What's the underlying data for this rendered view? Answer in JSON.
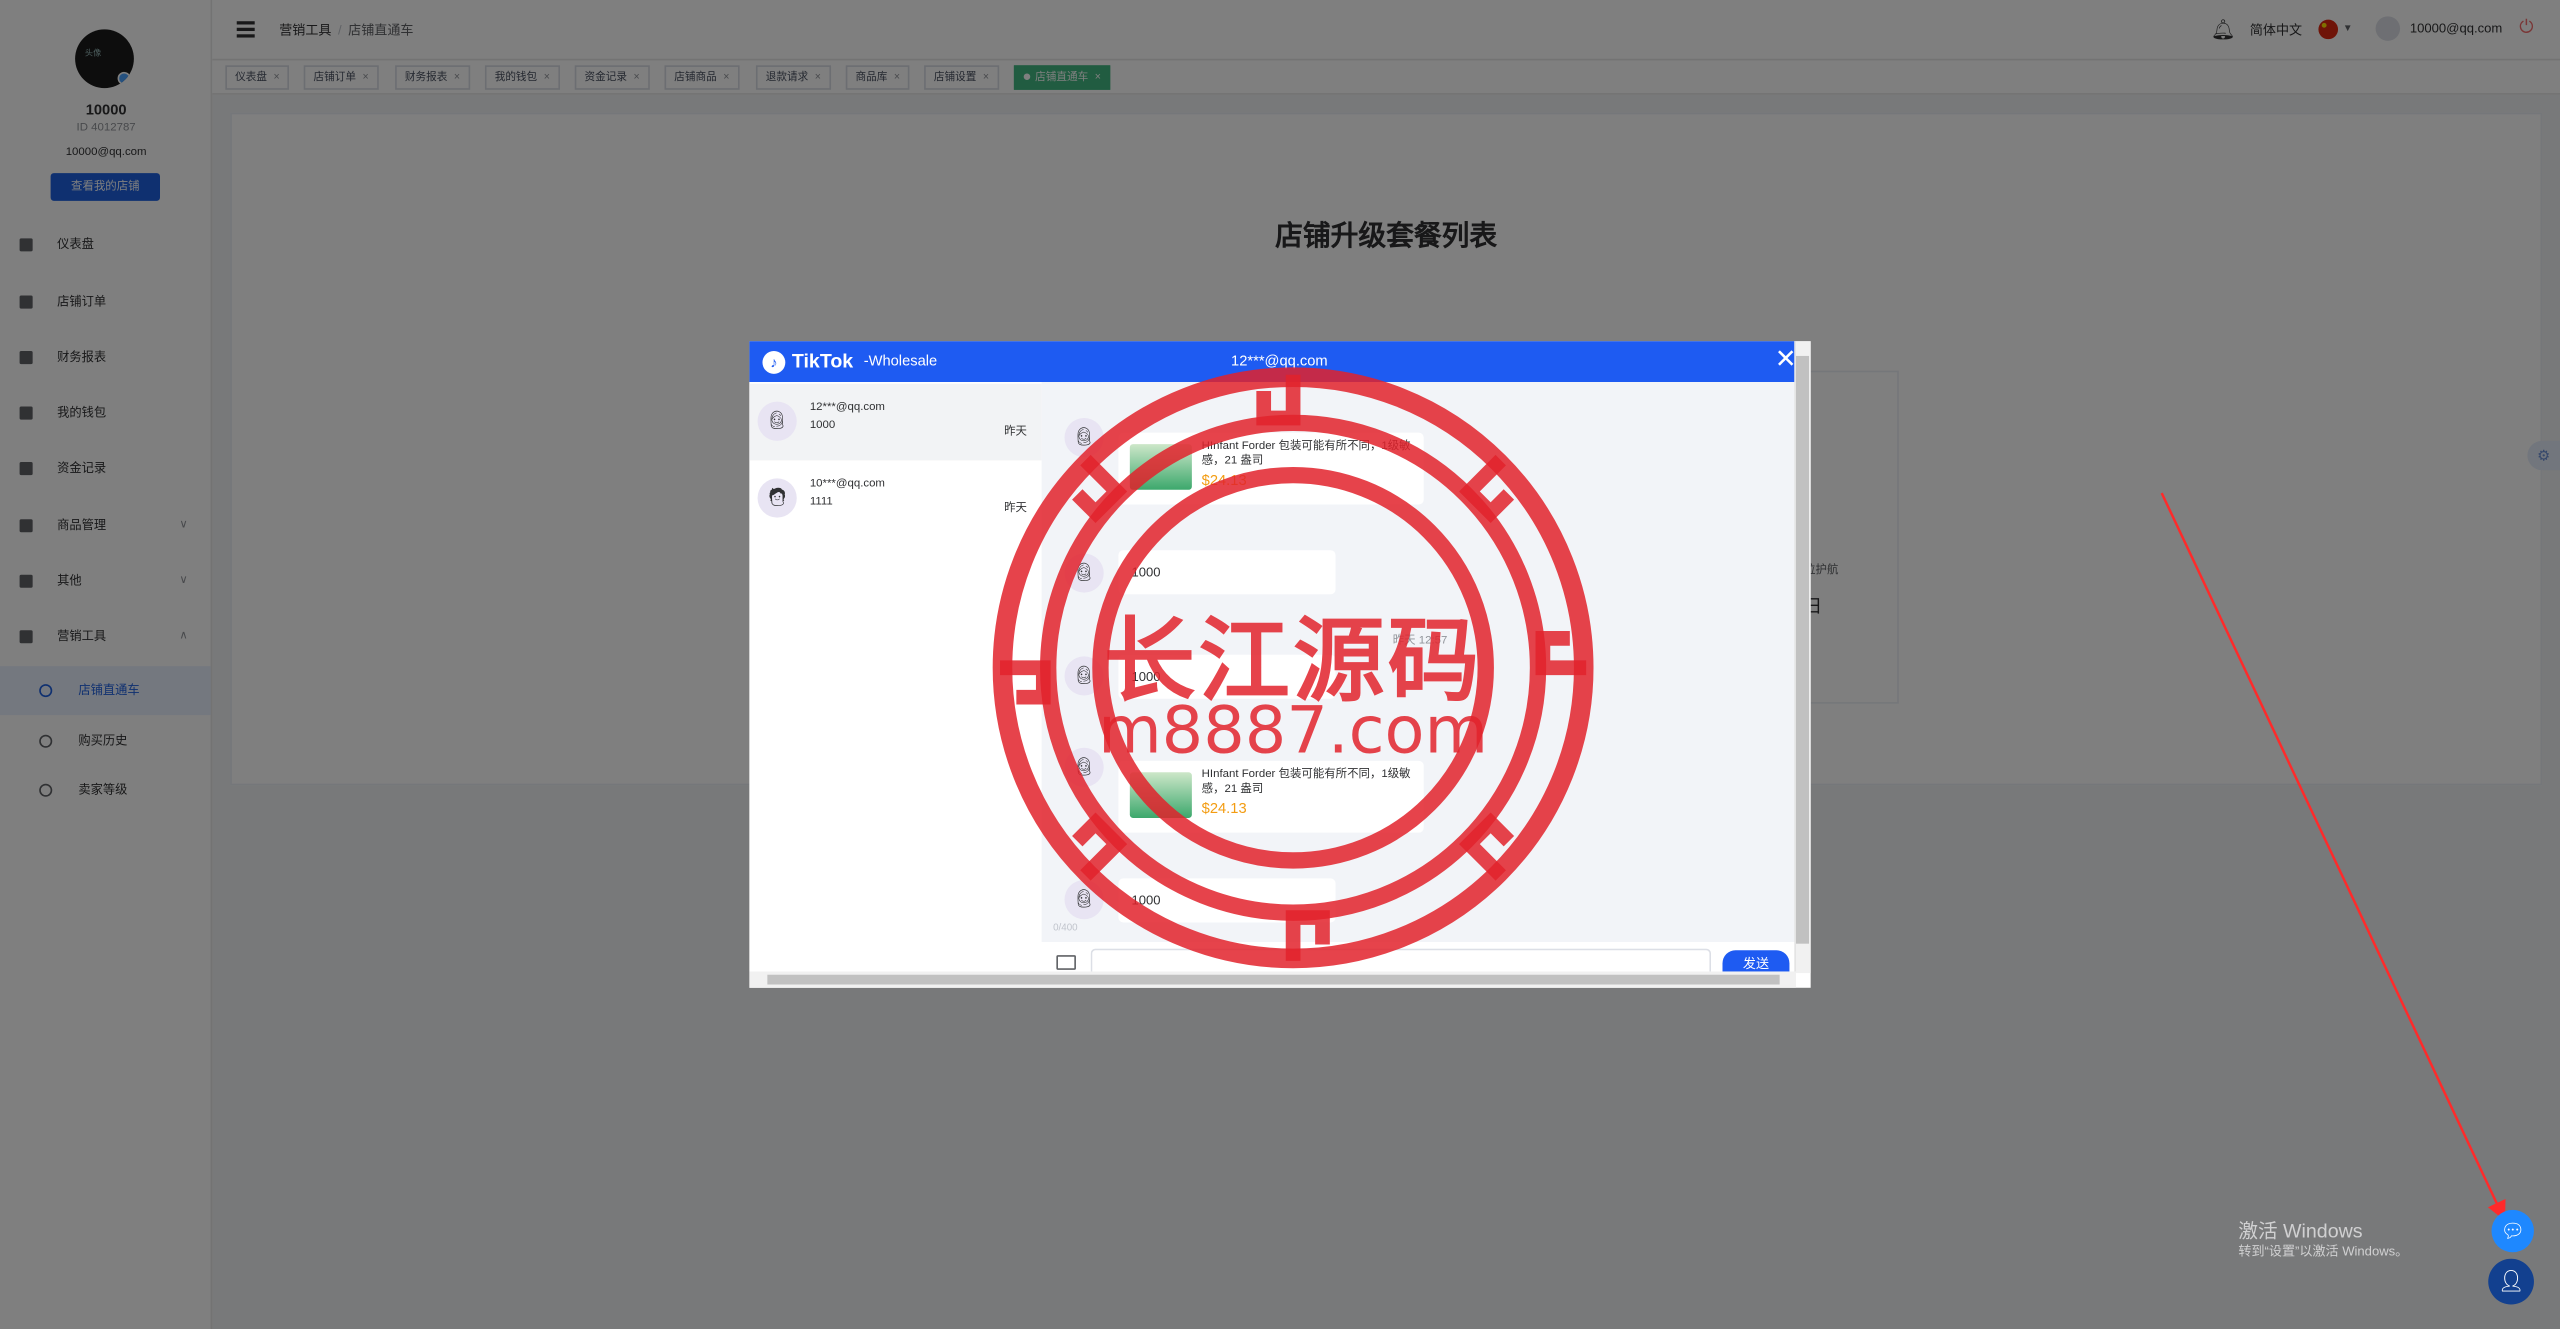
{
  "user": {
    "name": "10000",
    "id": "ID 4012787",
    "email": "10000@qq.com",
    "shop_button": "查看我的店铺"
  },
  "sidebar": {
    "items": [
      {
        "label": "仪表盘",
        "icon": "dashboard-icon"
      },
      {
        "label": "店铺订单",
        "icon": "clipboard-icon"
      },
      {
        "label": "财务报表",
        "icon": "chart-icon"
      },
      {
        "label": "我的钱包",
        "icon": "wallet-icon"
      },
      {
        "label": "资金记录",
        "icon": "document-icon"
      },
      {
        "label": "商品管理",
        "icon": "briefcase-icon",
        "expandable": true
      },
      {
        "label": "其他",
        "icon": "grid-icon",
        "expandable": true
      },
      {
        "label": "营销工具",
        "icon": "bar-chart-icon",
        "expanded": true
      }
    ],
    "subitems": [
      {
        "label": "店铺直通车",
        "icon": "truck-icon",
        "active": true
      },
      {
        "label": "购买历史",
        "icon": "clock-icon"
      },
      {
        "label": "卖家等级",
        "icon": "level-icon"
      }
    ]
  },
  "header": {
    "breadcrumb": [
      "营销工具",
      "店铺直通车"
    ],
    "language": "简体中文",
    "user_email": "10000@qq.com",
    "icons": [
      "hamburger-icon",
      "bell-icon",
      "china-flag-icon",
      "power-icon"
    ]
  },
  "tags": [
    {
      "label": "仪表盘"
    },
    {
      "label": "店铺订单"
    },
    {
      "label": "财务报表"
    },
    {
      "label": "我的钱包"
    },
    {
      "label": "资金记录"
    },
    {
      "label": "店铺商品"
    },
    {
      "label": "退款请求"
    },
    {
      "label": "商品库"
    },
    {
      "label": "店铺设置"
    },
    {
      "label": "店铺直通车",
      "active": true
    }
  ],
  "main": {
    "title": "店铺升级套餐列表",
    "plan_text": "位护航",
    "plan_day": "日"
  },
  "chat": {
    "brand": "TikTok",
    "brand_suffix": "-Wholesale",
    "peer": "12***@qq.com",
    "contacts": [
      {
        "email": "12***@qq.com",
        "last": "1000",
        "time": "昨天",
        "selected": true
      },
      {
        "email": "10***@qq.com",
        "last": "1111",
        "time": "昨天",
        "selected": false
      }
    ],
    "messages": [
      {
        "type": "product",
        "title": "HInfant Forder 包装可能有所不同，1级敏感，21 盎司",
        "price": "$24.13"
      },
      {
        "type": "text",
        "text": "1000"
      },
      {
        "type": "text",
        "text": "1000",
        "time": "昨天 12:57"
      },
      {
        "type": "product",
        "title": "HInfant Forder 包装可能有所不同，1级敏感，21 盎司",
        "price": "$24.13"
      },
      {
        "type": "text",
        "text": "1000"
      }
    ],
    "counter": "0/400",
    "send_label": "发送",
    "input_placeholder": ""
  },
  "watermark": {
    "line1": "长江源码",
    "line2": "m8887.com"
  },
  "windows_activation": {
    "line1": "激活 Windows",
    "line2": "转到“设置”以激活 Windows。"
  },
  "colors": {
    "primary": "#1e5bf2",
    "tag_active": "#42b983",
    "price": "#f39c12",
    "watermark": "#e2222c",
    "arrow": "#ff2a2a"
  }
}
